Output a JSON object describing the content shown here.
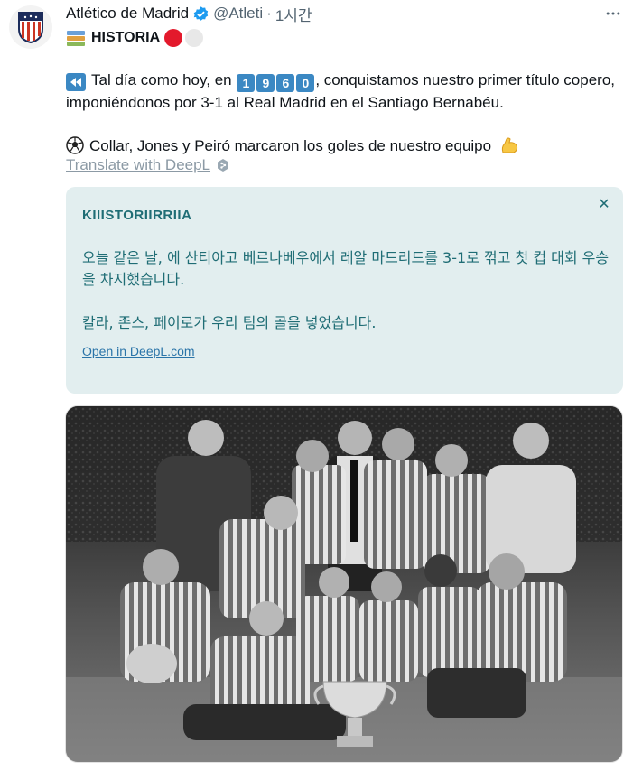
{
  "account": {
    "name": "Atlético de Madrid",
    "handle": "@Atleti",
    "separator": "·",
    "time": "1시간"
  },
  "tagline": {
    "text": "HISTORIA",
    "circle_colors": [
      "#e3192c",
      "#e8e8e8"
    ]
  },
  "tweet": {
    "line1_before": "Tal día como hoy, en",
    "year_digits": [
      "1",
      "9",
      "6",
      "0"
    ],
    "line1_after": ", conquistamos nuestro primer título copero, imponiéndonos por 3-1 al Real Madrid en el Santiago Bernabéu.",
    "line2": "Collar, Jones y Peiró marcaron los goles de nuestro equipo",
    "translate_link": "Translate with DeepL"
  },
  "translation": {
    "title": "KIIISTORIIRRIIA",
    "paragraph1": "오늘 같은 날, 에 산티아고 베르나베우에서 레알 마드리드를 3-1로 꺾고 첫 컵 대회 우승을 차지했습니다.",
    "paragraph2": "칼라, 존스, 페이로가 우리 팀의 골을 넣었습니다.",
    "open_link": "Open in DeepL.com",
    "close_symbol": "✕"
  },
  "colors": {
    "accent": "#1d9bf0",
    "translation_bg": "#e2eeef",
    "translation_text": "#1f6d75",
    "keycap": "#3b88c3"
  },
  "icons": {
    "avatar": "atletico-crest-icon",
    "verified": "verified-badge-icon",
    "more": "more-icon",
    "books": "books-emoji-icon",
    "rewind": "rewind-emoji-icon",
    "ball": "soccer-ball-icon",
    "muscle": "flexed-biceps-icon",
    "deepl": "deepl-icon",
    "close": "close-icon"
  }
}
